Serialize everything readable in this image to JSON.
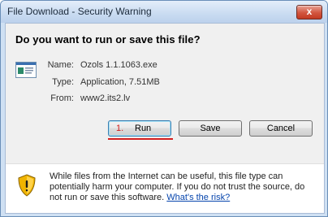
{
  "window": {
    "title": "File Download - Security Warning",
    "close_glyph": "x"
  },
  "dialog": {
    "question": "Do you want to run or save this file?",
    "file": {
      "name_label": "Name:",
      "name_value": "Ozols 1.1.1063.exe",
      "type_label": "Type:",
      "type_value": "Application, 7.51MB",
      "from_label": "From:",
      "from_value": "www2.its2.lv"
    },
    "buttons": {
      "run_step": "1.",
      "run_label": "Run",
      "save_label": "Save",
      "cancel_label": "Cancel"
    },
    "warning": {
      "text": "While files from the Internet can be useful, this file type can potentially harm your computer. If you do not trust the source, do not run or save this software.",
      "link": "What's the risk?"
    }
  },
  "colors": {
    "annotation_red": "#d42020",
    "link_blue": "#0645ad",
    "shield_yellow": "#f0b400"
  },
  "icons": [
    "file-icon",
    "shield-warning-icon",
    "close-icon"
  ]
}
